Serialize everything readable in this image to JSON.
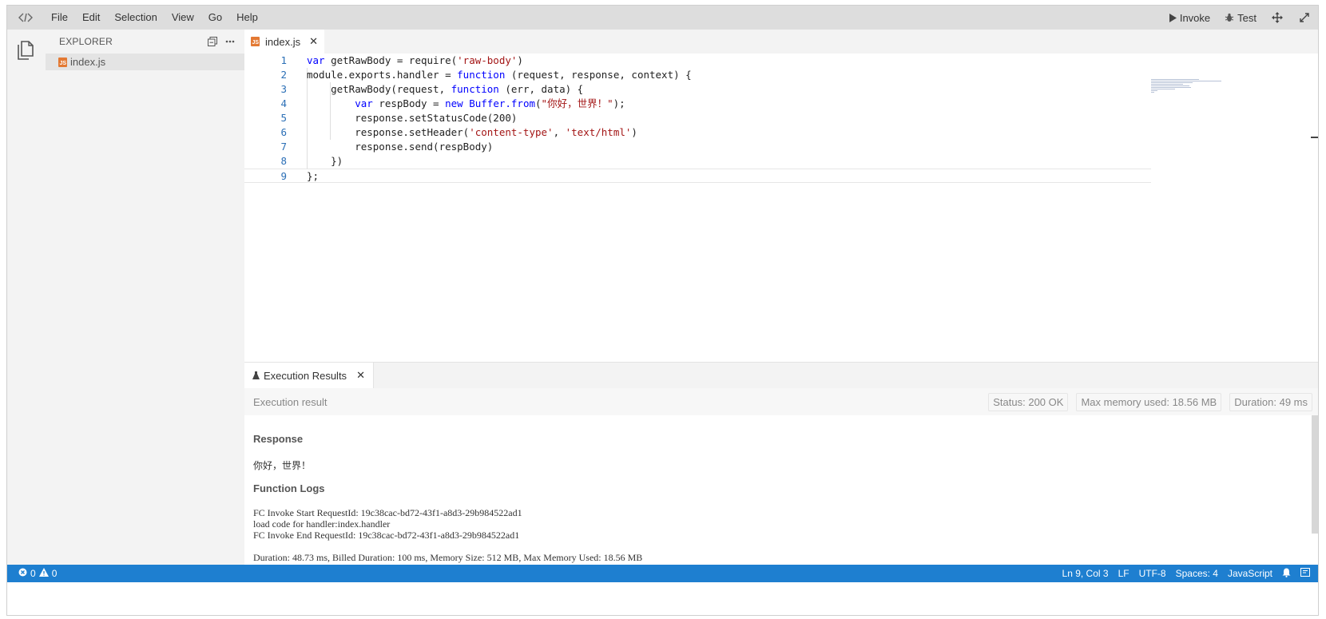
{
  "menu": {
    "logo_icon": "fc-logo-icon",
    "items": [
      "File",
      "Edit",
      "Selection",
      "View",
      "Go",
      "Help"
    ],
    "invoke_label": "Invoke",
    "test_label": "Test"
  },
  "sidebar": {
    "title": "EXPLORER",
    "files": [
      {
        "name": "index.js",
        "icon": "js-file-icon",
        "selected": true
      }
    ]
  },
  "editor": {
    "tab_label": "index.js",
    "close_glyph": "✕",
    "code_lines": [
      {
        "n": "1",
        "segments": [
          [
            "kw",
            "var"
          ],
          [
            "fn",
            " getRawBody = require("
          ],
          [
            "str",
            "'raw-body'"
          ],
          [
            "fn",
            ")"
          ]
        ]
      },
      {
        "n": "2",
        "segments": [
          [
            "fn",
            "module.exports.handler = "
          ],
          [
            "kw",
            "function"
          ],
          [
            "fn",
            " (request, response, context) {"
          ]
        ]
      },
      {
        "n": "3",
        "segments": [
          [
            "fn",
            "    getRawBody(request, "
          ],
          [
            "kw",
            "function"
          ],
          [
            "fn",
            " (err, data) {"
          ]
        ]
      },
      {
        "n": "4",
        "segments": [
          [
            "fn",
            "        "
          ],
          [
            "kw",
            "var"
          ],
          [
            "fn",
            " respBody = "
          ],
          [
            "kw",
            "new"
          ],
          [
            "fn",
            " "
          ],
          [
            "kw",
            "Buffer.from"
          ],
          [
            "fn",
            "("
          ],
          [
            "str",
            "\"你好，世界！\""
          ],
          [
            "fn",
            ");"
          ]
        ]
      },
      {
        "n": "5",
        "segments": [
          [
            "fn",
            "        response.setStatusCode(200)"
          ]
        ]
      },
      {
        "n": "6",
        "segments": [
          [
            "fn",
            "        response.setHeader("
          ],
          [
            "str",
            "'content-type'"
          ],
          [
            "fn",
            ", "
          ],
          [
            "str",
            "'text/html'"
          ],
          [
            "fn",
            ")"
          ]
        ]
      },
      {
        "n": "7",
        "segments": [
          [
            "fn",
            "        response.send(respBody)"
          ]
        ]
      },
      {
        "n": "8",
        "segments": [
          [
            "fn",
            "    })"
          ]
        ]
      },
      {
        "n": "9",
        "segments": [
          [
            "fn",
            "};"
          ]
        ]
      }
    ]
  },
  "panel": {
    "tab_label": "Execution Results",
    "result_label": "Execution result",
    "status": "Status: 200 OK",
    "max_memory": "Max memory used: 18.56 MB",
    "duration": "Duration: 49 ms",
    "response_title": "Response",
    "response_text": "你好，世界！",
    "logs_title": "Function Logs",
    "log_lines": [
      "FC Invoke Start RequestId: 19c38cac-bd72-43f1-a8d3-29b984522ad1",
      "load code for handler:index.handler",
      "FC Invoke End RequestId: 19c38cac-bd72-43f1-a8d3-29b984522ad1"
    ],
    "summary": "Duration: 48.73 ms, Billed Duration: 100 ms, Memory Size: 512 MB, Max Memory Used: 18.56 MB"
  },
  "statusbar": {
    "errors": "0",
    "warnings": "0",
    "position": "Ln 9, Col 3",
    "eol": "LF",
    "encoding": "UTF-8",
    "indent": "Spaces: 4",
    "language": "JavaScript"
  },
  "colors": {
    "statusbar": "#1e7fd0",
    "keyword": "#0000ff",
    "string": "#a31515",
    "line_number": "#2b6fb6",
    "js_badge": "#e37933"
  }
}
